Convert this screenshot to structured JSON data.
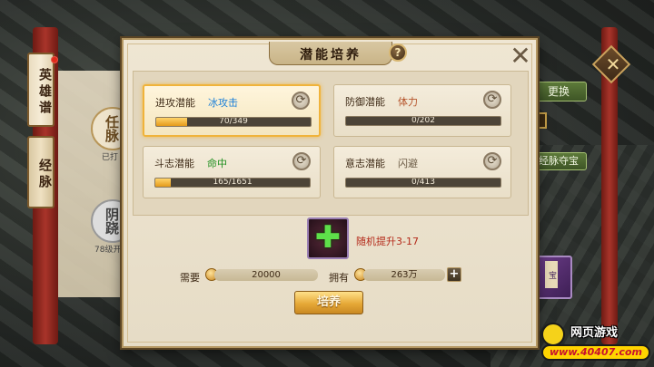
{
  "dialog": {
    "title": "潜能培养",
    "help_icon": "question-icon",
    "close_icon": "close-icon"
  },
  "left_tabs": [
    "英雄谱",
    "经脉"
  ],
  "background_panel": {
    "circle1": "任脉",
    "circle1_sub": "已打",
    "circle2": "阴跷",
    "circle2_sub": "78级开"
  },
  "side_panel": {
    "change_label": "更换",
    "meridian_treasure_label": "经脉夺宝",
    "book_label": "宝"
  },
  "stats": [
    {
      "name": "进攻潜能",
      "value": "冰攻击",
      "value_color": "#1a7fd8",
      "progress": "70/349",
      "fill": 0.2,
      "active": true
    },
    {
      "name": "防御潜能",
      "value": "体力",
      "value_color": "#b5532a",
      "progress": "0/202",
      "fill": 0,
      "active": false
    },
    {
      "name": "斗志潜能",
      "value": "命中",
      "value_color": "#1f8f1f",
      "progress": "165/1651",
      "fill": 0.1,
      "active": false
    },
    {
      "name": "意志潜能",
      "value": "闪避",
      "value_color": "#6a5a44",
      "progress": "0/413",
      "fill": 0,
      "active": false
    }
  ],
  "item": {
    "icon": "green-plus-icon",
    "description": "随机提升3-17"
  },
  "cost": {
    "need_label": "需要",
    "need_amount": "20000",
    "own_label": "拥有",
    "own_amount": "263万"
  },
  "cultivate_button": "培养",
  "watermark": {
    "title": "网页游戏",
    "url": "www.40407.com"
  },
  "colors": {
    "accent_gold": "#f0b33a",
    "desc_red": "#b42a1a"
  }
}
